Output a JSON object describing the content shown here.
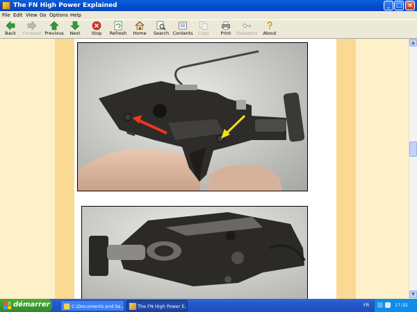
{
  "window": {
    "title": "The FN High Power Explained"
  },
  "menu": [
    "File",
    "Edit",
    "View",
    "Go",
    "Options",
    "Help"
  ],
  "toolbar": [
    {
      "label": "Back",
      "enabled": true
    },
    {
      "label": "Forward",
      "enabled": false
    },
    {
      "label": "Previous",
      "enabled": true
    },
    {
      "label": "Next",
      "enabled": true
    },
    {
      "label": "Stop",
      "enabled": true
    },
    {
      "label": "Refresh",
      "enabled": true
    },
    {
      "label": "Home",
      "enabled": true
    },
    {
      "label": "Search",
      "enabled": true
    },
    {
      "label": "Contents",
      "enabled": true
    },
    {
      "label": "Copy",
      "enabled": false
    },
    {
      "label": "Print",
      "enabled": true
    },
    {
      "label": "Password",
      "enabled": false
    },
    {
      "label": "About",
      "enabled": true
    }
  ],
  "icons": {
    "back": "arrow-left-icon",
    "forward": "arrow-right-icon",
    "previous": "arrow-up-icon",
    "next": "arrow-down-icon",
    "stop": "stop-icon",
    "refresh": "refresh-icon",
    "home": "home-icon",
    "search": "search-icon",
    "contents": "book-icon",
    "copy": "copy-icon",
    "print": "printer-icon",
    "password": "key-icon",
    "about": "question-icon"
  },
  "colors": {
    "page_background": "#FEF0C8",
    "page_strip": "#FAD993",
    "arrow_red": "#E8391E",
    "arrow_yellow": "#F2E21A"
  },
  "taskbar": {
    "start_label": "démarrer",
    "tasks": [
      "C:\\Documents and Se...",
      "The FN High Power E..."
    ],
    "language": "FR",
    "clock": "17:32"
  }
}
